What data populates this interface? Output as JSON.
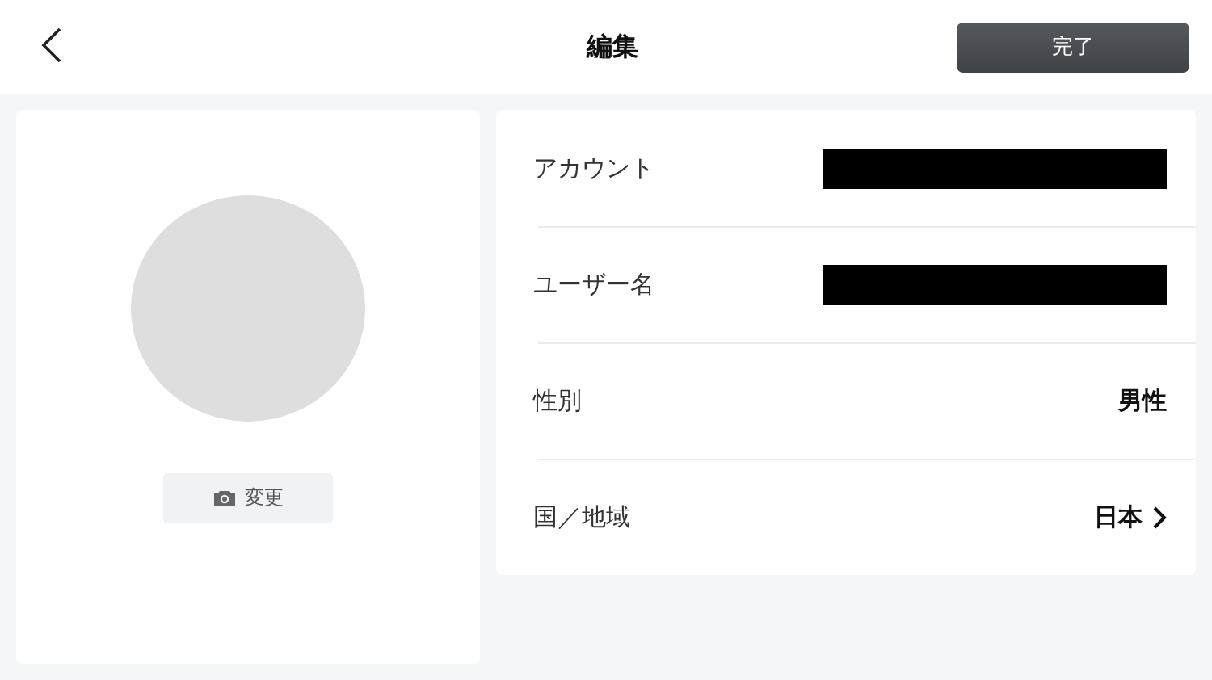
{
  "header": {
    "title": "編集",
    "done_button": "完了"
  },
  "profile": {
    "change_button": "変更"
  },
  "fields": [
    {
      "label": "アカウント",
      "kind": "redacted"
    },
    {
      "label": "ユーザー名",
      "kind": "redacted"
    },
    {
      "label": "性別",
      "kind": "value",
      "value": "男性"
    },
    {
      "label": "国／地域",
      "kind": "link",
      "value": "日本"
    }
  ]
}
